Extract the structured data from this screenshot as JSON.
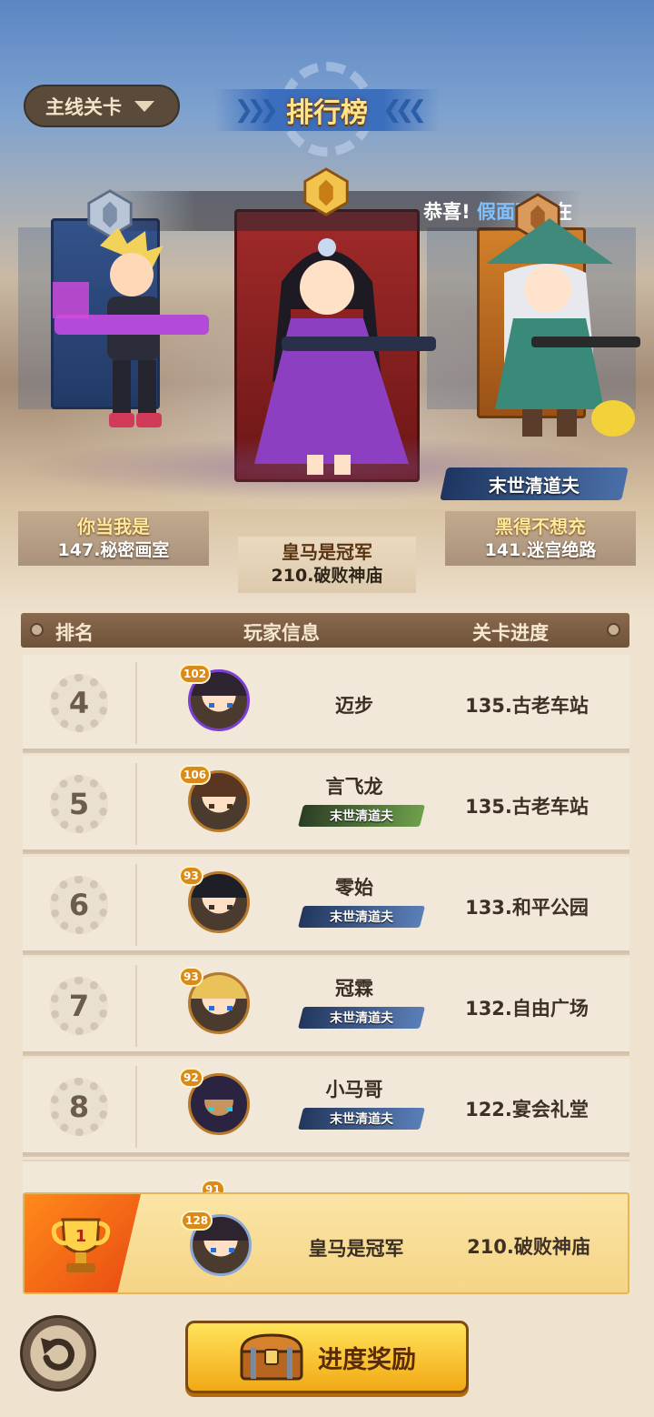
{
  "header": {
    "dropdown_label": "主线关卡",
    "title": "排行榜"
  },
  "ticker": {
    "prefix": "恭喜!",
    "highlight": "假面骑士",
    "suffix": "在"
  },
  "podium": {
    "first": {
      "name": "皇马是冠军",
      "stage": "210.破败神庙"
    },
    "second": {
      "name": "你当我是",
      "stage": "147.秘密画室"
    },
    "third": {
      "name": "黑得不想充",
      "stage": "141.迷宫绝路",
      "weapon": "末世清道夫"
    }
  },
  "table": {
    "headers": [
      "排名",
      "玩家信息",
      "关卡进度"
    ],
    "rows": [
      {
        "rank": "4",
        "level": "102",
        "name": "迈步",
        "weapon": "",
        "stage": "135.古老车站"
      },
      {
        "rank": "5",
        "level": "106",
        "name": "言飞龙",
        "weapon": "末世清道夫",
        "stage": "135.古老车站"
      },
      {
        "rank": "6",
        "level": "93",
        "name": "零始",
        "weapon": "末世清道夫",
        "stage": "133.和平公园"
      },
      {
        "rank": "7",
        "level": "93",
        "name": "冠霖",
        "weapon": "末世清道夫",
        "stage": "132.自由广场"
      },
      {
        "rank": "8",
        "level": "92",
        "name": "小马哥",
        "weapon": "末世清道夫",
        "stage": "122.宴会礼堂"
      },
      {
        "level": "91"
      }
    ]
  },
  "my_rank": {
    "rank": "1",
    "level": "128",
    "name": "皇马是冠军",
    "stage": "210.破败神庙"
  },
  "footer": {
    "reward_button": "进度奖励"
  },
  "colors": {
    "accent_gold": "#ffe38a",
    "highlight_blue": "#7fc1ff",
    "my_row": "#f5d585",
    "badge_orange": "#e84a12"
  }
}
